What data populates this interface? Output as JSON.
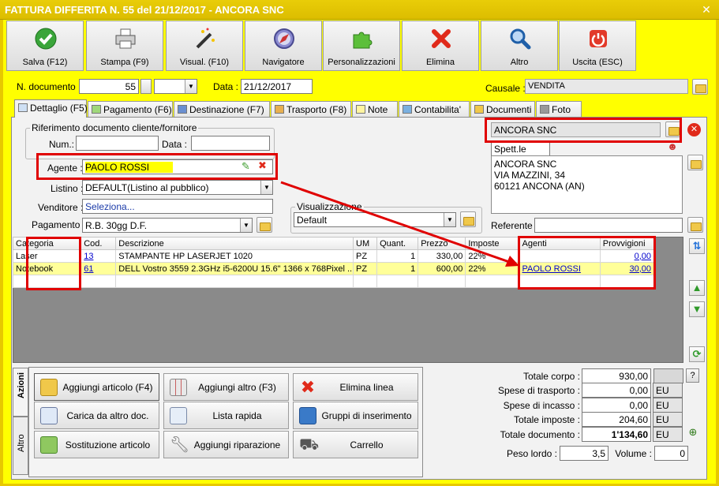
{
  "window": {
    "title": "FATTURA DIFFERITA N. 55 del 21/12/2017 - ANCORA SNC",
    "close": "✕"
  },
  "toolbar": [
    {
      "label": "Salva (F12)",
      "icon": "save-check-icon"
    },
    {
      "label": "Stampa (F9)",
      "icon": "printer-icon"
    },
    {
      "label": "Visual. (F10)",
      "icon": "magic-wand-icon"
    },
    {
      "label": "Navigatore",
      "icon": "compass-icon"
    },
    {
      "label": "Personalizzazioni",
      "icon": "puzzle-icon"
    },
    {
      "label": "Elimina",
      "icon": "delete-x-icon"
    },
    {
      "label": "Altro",
      "icon": "magnifier-icon"
    },
    {
      "label": "Uscita (ESC)",
      "icon": "power-icon"
    }
  ],
  "header": {
    "doc_label": "N. documento :",
    "doc_number": "55",
    "date_label": "Data :",
    "date": "21/12/2017",
    "causale_label": "Causale :",
    "causale": "VENDITA"
  },
  "tabs": [
    "Dettaglio (F5)",
    "Pagamento (F6)",
    "Destinazione (F7)",
    "Trasporto (F8)",
    "Note",
    "Contabilita'",
    "Documenti",
    "Foto"
  ],
  "riferimento": {
    "title": "Riferimento documento cliente/fornitore",
    "num_label": "Num.:",
    "data_label": "Data :"
  },
  "fields": {
    "agente_label": "Agente :",
    "agente": "PAOLO ROSSI",
    "listino_label": "Listino :",
    "listino": "DEFAULT(Listino al pubblico)",
    "venditore_label": "Venditore :",
    "venditore": "Seleziona...",
    "pagamento_label": "Pagamento :",
    "pagamento": "R.B. 30gg D.F.",
    "visualizzazione_label": "Visualizzazione",
    "visualizzazione": "Default"
  },
  "cliente": {
    "name": "ANCORA SNC",
    "spett": "Spett.le",
    "address_lines": [
      "ANCORA SNC",
      "VIA MAZZINI, 34",
      "60121 ANCONA (AN)"
    ],
    "referente_label": "Referente"
  },
  "grid": {
    "headers": [
      "Categoria",
      "Cod.",
      "Descrizione",
      "UM",
      "Quant.",
      "Prezzo",
      "Imposte",
      "Agenti",
      "Provvigioni"
    ],
    "rows": [
      {
        "categoria": "Laser",
        "cod": "13",
        "descrizione": "STAMPANTE HP LASERJET 1020",
        "um": "PZ",
        "quant": "1",
        "prezzo": "330,00",
        "imposte": "22%",
        "agenti": "",
        "provvigioni": "0,00"
      },
      {
        "categoria": "Notebook",
        "cod": "61",
        "descrizione": "DELL Vostro 3559 2.3GHz i5-6200U 15.6\" 1366 x 768Pixel ...",
        "um": "PZ",
        "quant": "1",
        "prezzo": "600,00",
        "imposte": "22%",
        "agenti": "PAOLO ROSSI",
        "provvigioni": "30,00"
      }
    ]
  },
  "side_tabs": [
    "Azioni",
    "Altro"
  ],
  "actions": [
    {
      "label": "Aggiungi articolo (F4)",
      "icon": "add-article-icon"
    },
    {
      "label": "Aggiungi altro (F3)",
      "icon": "add-grid-icon"
    },
    {
      "label": "Elimina linea",
      "icon": "delete-line-icon"
    },
    {
      "label": "Carica da altro doc.",
      "icon": "load-doc-icon"
    },
    {
      "label": "Lista rapida",
      "icon": "quick-list-icon"
    },
    {
      "label": "Gruppi di inserimento",
      "icon": "insert-group-icon"
    },
    {
      "label": "Sostituzione articolo",
      "icon": "replace-article-icon"
    },
    {
      "label": "Aggiungi riparazione",
      "icon": "wrench-icon"
    },
    {
      "label": "Carrello",
      "icon": "cart-icon"
    }
  ],
  "totals": {
    "totale_corpo_label": "Totale corpo :",
    "totale_corpo": "930,00",
    "help": "?",
    "spese_trasporto_label": "Spese di trasporto :",
    "spese_trasporto": "0,00",
    "spese_incasso_label": "Spese di incasso :",
    "spese_incasso": "0,00",
    "totale_imposte_label": "Totale imposte :",
    "totale_imposte": "204,60",
    "totale_documento_label": "Totale documento :",
    "totale_documento": "1'134,60",
    "currency": "EU",
    "peso_label": "Peso lordo :",
    "peso": "3,5",
    "volume_label": "Volume :",
    "volume": "0"
  },
  "colors": {
    "window_yellow": "#ffff00",
    "highlight_red": "#e00000",
    "selected_row": "#ffff99"
  }
}
